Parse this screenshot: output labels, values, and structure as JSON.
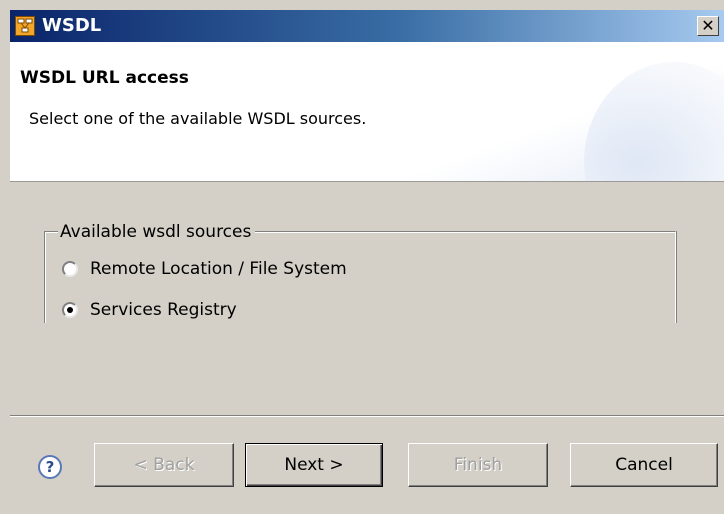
{
  "window": {
    "title": "WSDL",
    "close_symbol": "✕"
  },
  "banner": {
    "title": "WSDL URL access",
    "description": "Select one of the available WSDL sources."
  },
  "sources_group": {
    "legend": "Available wsdl sources",
    "options": [
      {
        "label": "Remote Location / File System",
        "selected": false
      },
      {
        "label": "Services Registry",
        "selected": true
      }
    ]
  },
  "footer": {
    "help_symbol": "?",
    "back_label": "< Back",
    "next_label": "Next >",
    "finish_label": "Finish",
    "cancel_label": "Cancel"
  },
  "colors": {
    "titlebar_start": "#0a246a",
    "titlebar_end": "#a6caf0",
    "dialog_bg": "#d4d0c8"
  },
  "icons": {
    "app": "wsdl-app-icon",
    "close": "close-icon",
    "help": "help-icon"
  }
}
